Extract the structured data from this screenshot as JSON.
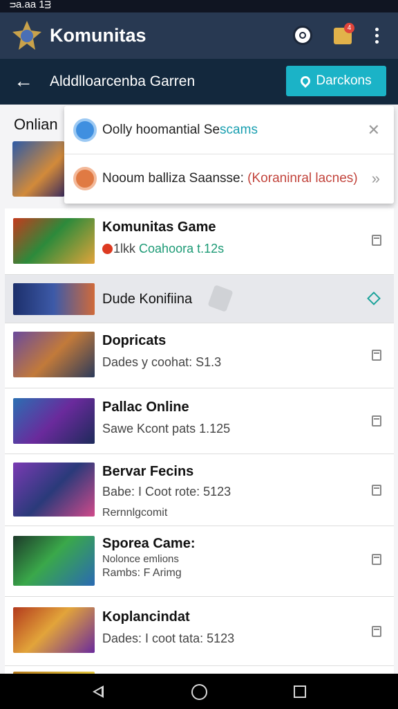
{
  "status_bar": {
    "text": "ᴝa.aa 1ᴟ"
  },
  "app_bar": {
    "title": "Komunitas",
    "notification_count": "4",
    "icons": [
      "app-logo-icon",
      "circle-icon",
      "box-icon",
      "more-vert-icon"
    ]
  },
  "sub_bar": {
    "back_label": "←",
    "title": "Alddlloarcenba Garren",
    "button_label": "Darckons"
  },
  "section": {
    "header": "Onlian"
  },
  "dropdown": {
    "item1": {
      "part1": "Oolly  hoomantial Se",
      "part2": "scams",
      "end": "✕"
    },
    "item2": {
      "part1": "Nooum balliza Saansse:  ",
      "part2": "(Koraninral lacnes)",
      "end": "»"
    }
  },
  "rows": [
    {
      "title": "Komunitas Game",
      "sub_prefix": "1lkk",
      "sub_main": "Coahoora t.12s"
    },
    {
      "title": "Dude Konifiina"
    },
    {
      "title": "Dopricats",
      "sub": "Dades y coohat: S1.3"
    },
    {
      "title": "Pallac Online",
      "sub": "Sawe Kcont pats 1.125"
    },
    {
      "title": "Bervar Fecins",
      "sub": "Babe: I Coot rote: 5123",
      "sub2": "Rernnlgcomit"
    },
    {
      "title": "Sporea Came:",
      "sub": "Nolonce emlions",
      "sub2": "Rambs: F Arimg"
    },
    {
      "title": "Koplancindat",
      "sub": "Dades: I coot tata: 5123"
    }
  ],
  "colors": {
    "app_bar": "#283952",
    "sub_bar": "#13283d",
    "accent": "#1bb3c7",
    "teal_text": "#199fb0",
    "red_text": "#c2443c"
  }
}
